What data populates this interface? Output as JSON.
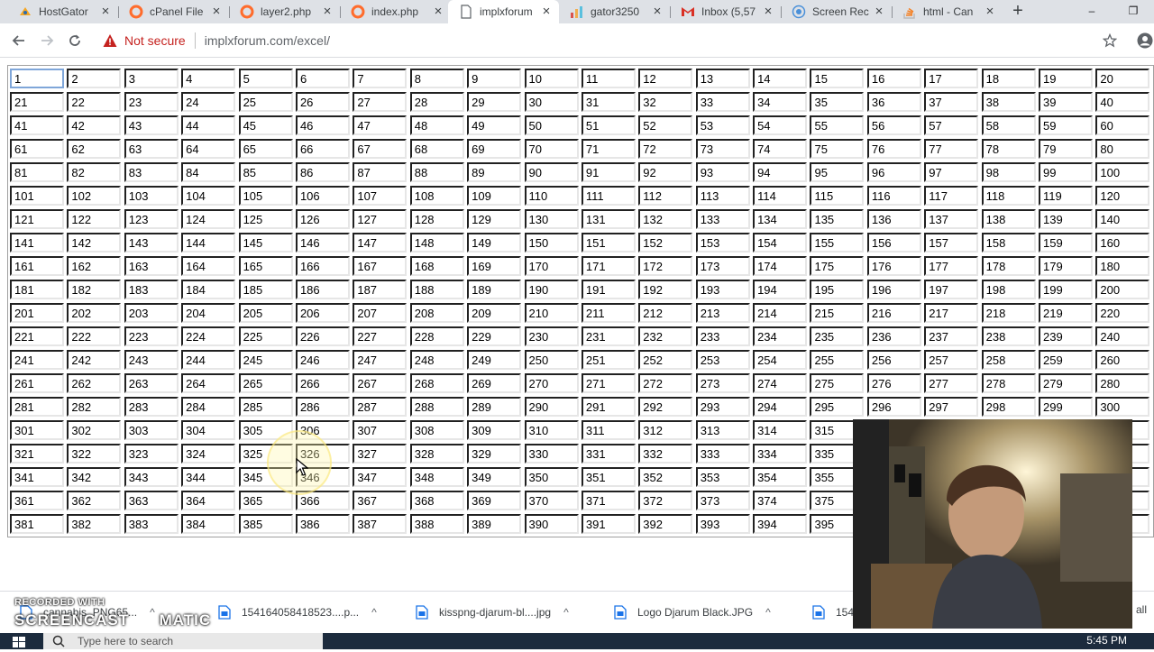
{
  "browser": {
    "tabs": [
      {
        "title": "HostGator",
        "icon": "hostgator-icon",
        "active": false
      },
      {
        "title": "cPanel File",
        "icon": "cpanel-icon",
        "active": false
      },
      {
        "title": "layer2.php",
        "icon": "cpanel-icon",
        "active": false
      },
      {
        "title": "index.php",
        "icon": "cpanel-icon",
        "active": false
      },
      {
        "title": "implxforum",
        "icon": "page-icon",
        "active": true
      },
      {
        "title": "gator3250",
        "icon": "awstats-icon",
        "active": false
      },
      {
        "title": "Inbox (5,57",
        "icon": "gmail-icon",
        "active": false
      },
      {
        "title": "Screen Rec",
        "icon": "screencast-icon",
        "active": false
      },
      {
        "title": "html - Can",
        "icon": "stackoverflow-icon",
        "active": false
      }
    ],
    "new_tab_symbol": "+",
    "window_controls": {
      "minimize": "–",
      "restore": "❐"
    },
    "security_label": "Not secure",
    "url": "implxforum.com/excel/"
  },
  "grid": {
    "rows": 20,
    "columns": 20
  },
  "downloads": {
    "items": [
      {
        "name": "cannabis_PNG65...",
        "icon": "file-icon"
      },
      {
        "name": "154164058418523....p...",
        "icon": "file-icon"
      },
      {
        "name": "kisspng-djarum-bl....jpg",
        "icon": "image-file-icon"
      },
      {
        "name": "Logo Djarum Black.JPG",
        "icon": "image-file-icon"
      },
      {
        "name": "154",
        "icon": "file-icon"
      }
    ],
    "show_all": "all"
  },
  "watermark": {
    "line1": "RECORDED WITH",
    "line2": "SCREENCAST",
    "line3": "MATIC"
  },
  "taskbar": {
    "search_placeholder": "Type here to search",
    "clock": "5:45 PM"
  },
  "colors": {
    "tabstrip": "#dee1e6",
    "security_warning": "#c5221f",
    "taskbar": "#1c2b3d"
  }
}
